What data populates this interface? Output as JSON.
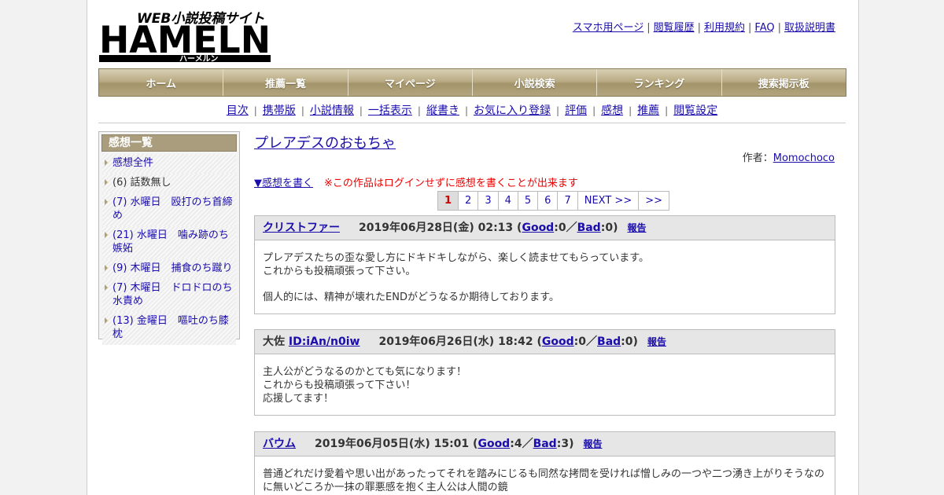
{
  "header": {
    "logo_text": "HAMELN",
    "logo_tagline": "WEB小説投稿サイト",
    "logo_kana": "ハーメルン",
    "top_links": [
      "スマホ用ページ",
      "閲覧履歴",
      "利用規約",
      "FAQ",
      "取扱説明書"
    ]
  },
  "main_nav": [
    "ホーム",
    "推薦一覧",
    "マイページ",
    "小説検索",
    "ランキング",
    "捜索掲示板"
  ],
  "sub_nav": [
    "目次",
    "携帯版",
    "小説情報",
    "一括表示",
    "縦書き",
    "お気に入り登録",
    "評価",
    "感想",
    "推薦",
    "閲覧設定"
  ],
  "sidebar": {
    "title": "感想一覧",
    "items": [
      {
        "label": "感想全件",
        "link": true
      },
      {
        "label": "(6) 話数無し",
        "link": false
      },
      {
        "label": "(7) 水曜日　殴打のち首締め",
        "link": true
      },
      {
        "label": "(21) 水曜日　噛み跡のち嫉妬",
        "link": true
      },
      {
        "label": "(9) 木曜日　捕食のち蹴り",
        "link": true
      },
      {
        "label": "(7) 木曜日　ドロドロのち水責め",
        "link": true
      },
      {
        "label": "(13) 金曜日　嘔吐のち膝枕",
        "link": true
      }
    ]
  },
  "work": {
    "title": "プレアデスのおもちゃ",
    "author_label": "作者：",
    "author": "Momochoco",
    "write_link": "▼感想を書く",
    "warning": "※この作品はログインせずに感想を書くことが出来ます"
  },
  "pager": [
    "1",
    "2",
    "3",
    "4",
    "5",
    "6",
    "7",
    "NEXT >>",
    ">>"
  ],
  "reviews": [
    {
      "prefix": "",
      "name": "クリストファー",
      "date": "2019年06月28日(金) 02:13",
      "good_label": "Good",
      "good": "0",
      "bad_label": "Bad",
      "bad": "0",
      "report": "報告",
      "paragraphs": [
        "プレアデスたちの歪な愛し方にドキドキしながら、楽しく読ませてもらっています。\nこれからも投稿頑張って下さい。",
        "個人的には、精神が壊れたENDがどうなるか期待しております。"
      ]
    },
    {
      "prefix": "大佐 ",
      "name": "ID:iAn/n0iw",
      "date": "2019年06月26日(水) 18:42",
      "good_label": "Good",
      "good": "0",
      "bad_label": "Bad",
      "bad": "0",
      "report": "報告",
      "paragraphs": [
        "主人公がどうなるのかとても気になります！\nこれからも投稿頑張って下さい！\n応援してます！"
      ]
    },
    {
      "prefix": "",
      "name": "バウム",
      "date": "2019年06月05日(水) 15:01",
      "good_label": "Good",
      "good": "4",
      "bad_label": "Bad",
      "bad": "3",
      "report": "報告",
      "paragraphs": [
        "普通どれだけ愛着や思い出があったってそれを踏みにじるも同然な拷問を受ければ憎しみの一つや二つ湧き上がりそうなのに無いどころか一抹の罪悪感を抱く主人公は人間の鏡"
      ]
    }
  ],
  "colors": {
    "link": "#1a0dab",
    "nav_gold": "#b3a57e",
    "warning": "#ee0000",
    "active_page": "#cc0000"
  }
}
